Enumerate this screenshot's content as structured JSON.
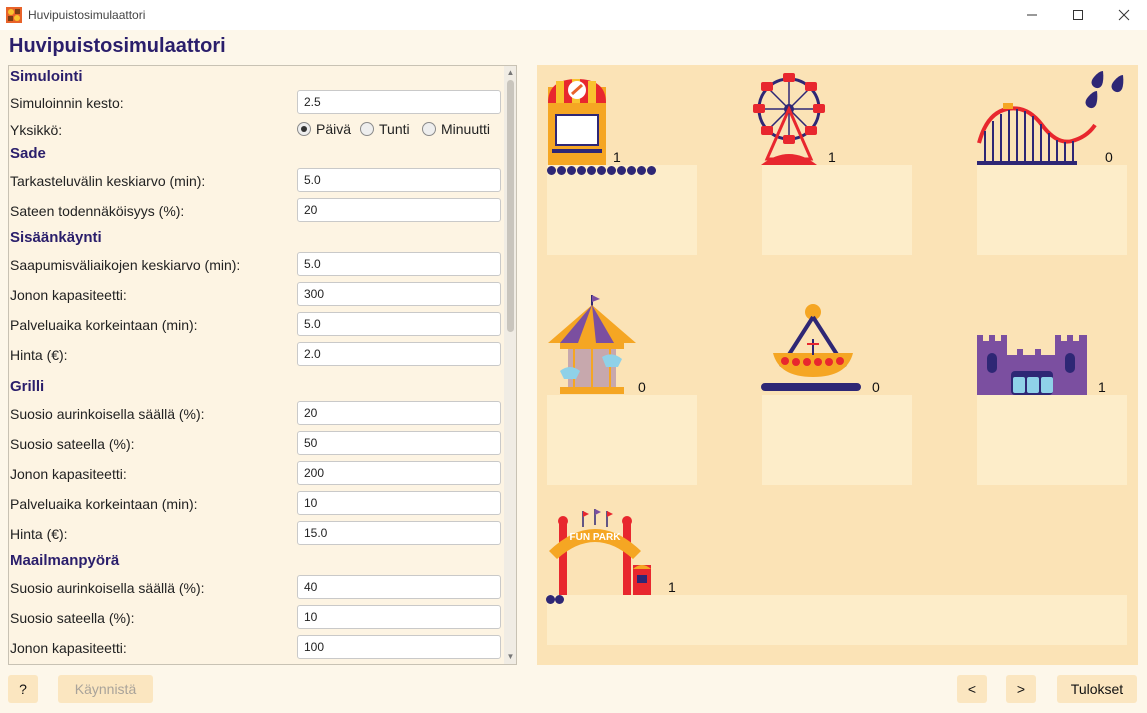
{
  "window": {
    "title": "Huvipuistosimulaattori",
    "minimize_label": "—",
    "maximize_label": "☐",
    "close_label": "✕"
  },
  "app": {
    "heading": "Huvipuistosimulaattori"
  },
  "settings": {
    "simulointi": {
      "title": "Simulointi",
      "duration_label": "Simuloinnin kesto:",
      "duration_value": "2.5",
      "unit_label": "Yksikkö:",
      "unit_options": [
        "Päivä",
        "Tunti",
        "Minuutti"
      ],
      "unit_selected": "Päivä"
    },
    "sade": {
      "title": "Sade",
      "interval_label": "Tarkasteluvälin keskiarvo (min):",
      "interval_value": "5.0",
      "probability_label": "Sateen todennäköisyys (%):",
      "probability_value": "20"
    },
    "sisaankaynti": {
      "title": "Sisäänkäynti",
      "arrival_label": "Saapumisväliaikojen keskiarvo (min):",
      "arrival_value": "5.0",
      "capacity_label": "Jonon kapasiteetti:",
      "capacity_value": "300",
      "service_label": "Palveluaika korkeintaan (min):",
      "service_value": "5.0",
      "price_label": "Hinta (€):",
      "price_value": "2.0"
    },
    "grilli": {
      "title": "Grilli",
      "sunny_label": "Suosio aurinkoisella säällä (%):",
      "sunny_value": "20",
      "rainy_label": "Suosio sateella (%):",
      "rainy_value": "50",
      "capacity_label": "Jonon kapasiteetti:",
      "capacity_value": "200",
      "service_label": "Palveluaika korkeintaan (min):",
      "service_value": "10",
      "price_label": "Hinta (€):",
      "price_value": "15.0"
    },
    "maailmanpyora": {
      "title": "Maailmanpyörä",
      "sunny_label": "Suosio aurinkoisella säällä (%):",
      "sunny_value": "40",
      "rainy_label": "Suosio sateella (%):",
      "rainy_value": "10",
      "capacity_label": "Jonon kapasiteetti:",
      "capacity_value": "100"
    }
  },
  "simulation": {
    "grill_count": "1",
    "grill_queue": 11,
    "ferris_count": "1",
    "coaster_count": "0",
    "carousel_count": "0",
    "pirate_ship_count": "0",
    "castle_count": "1",
    "entrance_count": "1",
    "entrance_queue": 2,
    "entrance_sign": "FUN PARK",
    "raining": true
  },
  "buttons": {
    "help": "?",
    "start": "Käynnistä",
    "prev": "<",
    "next": ">",
    "results": "Tulokset"
  },
  "colors": {
    "heading": "#2a1e6b",
    "sim_background": "#fbe3b6",
    "station_box": "#fdedc9",
    "queue": "#2e2775"
  }
}
